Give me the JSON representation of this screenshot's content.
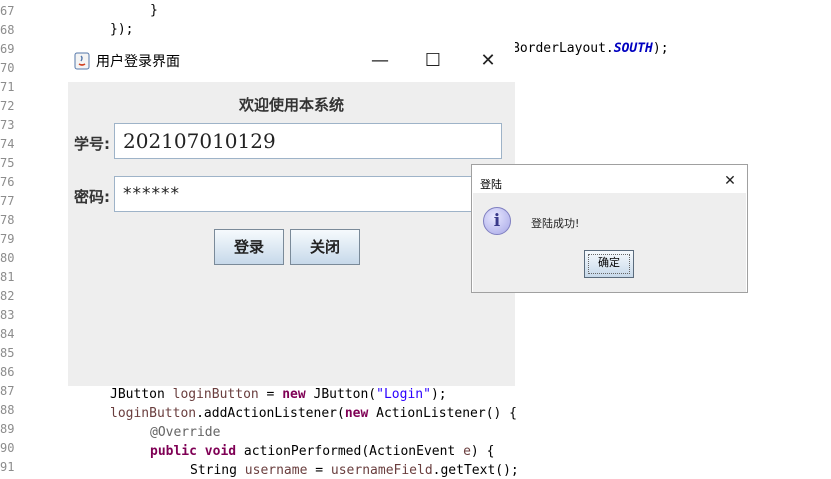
{
  "editor": {
    "line_numbers": [
      "67",
      "68",
      "69",
      "70",
      "71",
      "72",
      "73",
      "74",
      "75",
      "76",
      "77",
      "78",
      "79",
      "80",
      "81",
      "82",
      "83",
      "84",
      "85",
      "86",
      "87",
      "88",
      "89",
      "90",
      "91"
    ],
    "code_close_brace": "}",
    "code_close_paren": "});",
    "code_border_prefix": "BorderLayout.",
    "code_border_const": "SOUTH",
    "code_border_suffix": ");",
    "code_87_a": "JButton ",
    "code_87_var": "loginButton",
    "code_87_b": " = ",
    "code_87_kw": "new",
    "code_87_c": " JButton(",
    "code_87_str": "\"Login\"",
    "code_87_d": ");",
    "code_88_var": "loginButton",
    "code_88_a": ".addActionListener(",
    "code_88_kw": "new",
    "code_88_b": " ActionListener() {",
    "code_89_ann": "@Override",
    "code_90_kw1": "public",
    "code_90_kw2": "void",
    "code_90_a": " actionPerformed(ActionEvent ",
    "code_90_var": "e",
    "code_90_b": ") {",
    "code_91_a": "String ",
    "code_91_var1": "username",
    "code_91_b": " = ",
    "code_91_var2": "usernameField",
    "code_91_c": ".getText();"
  },
  "login_window": {
    "title": "用户登录界面",
    "minimize_glyph": "—",
    "maximize_glyph": "☐",
    "close_glyph": "✕",
    "welcome": "欢迎使用本系统",
    "id_label": "学号:",
    "id_value": "202107010129",
    "pwd_label": "密码:",
    "pwd_value": "******",
    "login_button": "登录",
    "close_button": "关闭"
  },
  "dialog": {
    "title": "登陆",
    "close_glyph": "✕",
    "icon_glyph": "i",
    "message": "登陆成功!",
    "ok_button": "确定"
  }
}
